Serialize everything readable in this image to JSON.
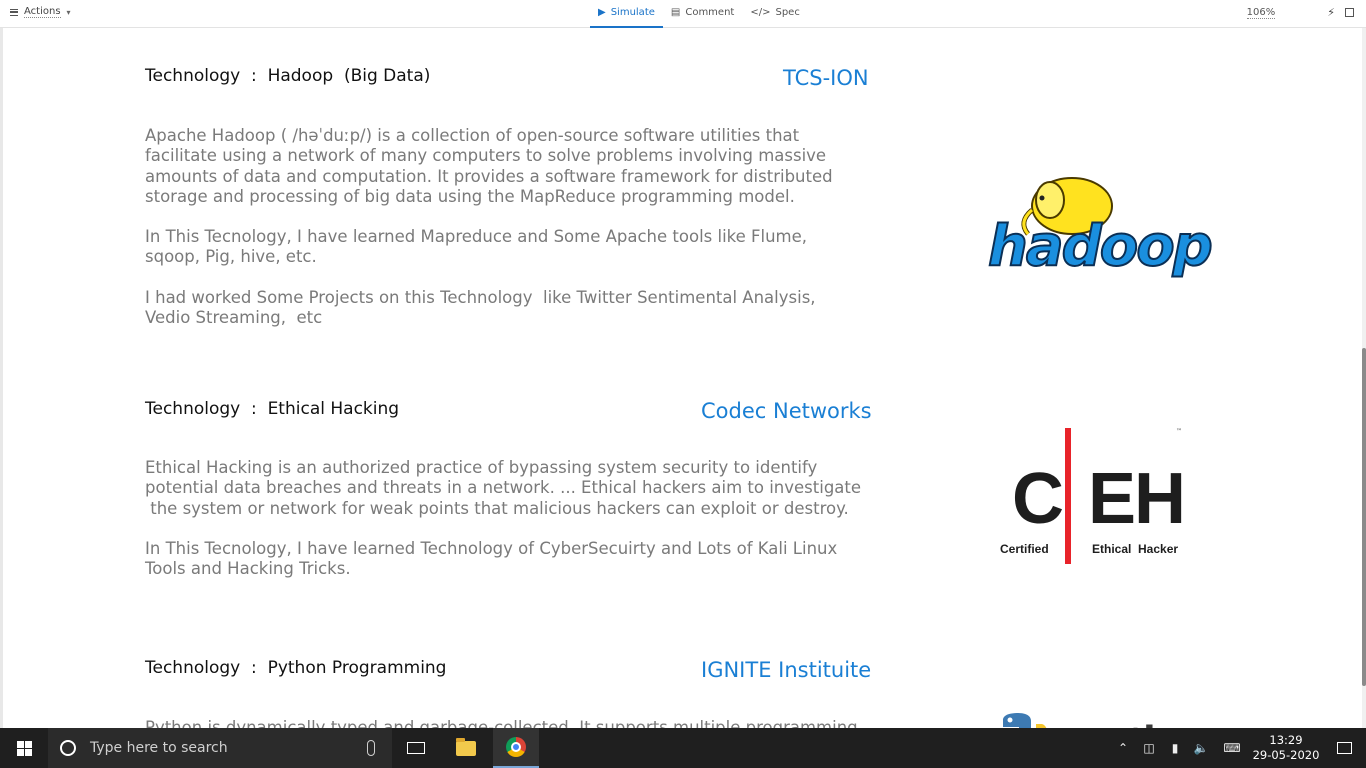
{
  "toolbar": {
    "actions_label": "Actions",
    "tabs": [
      {
        "label": "Simulate",
        "icon": "play-icon",
        "active": true
      },
      {
        "label": "Comment",
        "icon": "comment-icon",
        "active": false
      },
      {
        "label": "Spec",
        "icon": "code-icon",
        "active": false
      }
    ],
    "zoom": "106%"
  },
  "sections": [
    {
      "title": "Technology  :  Hadoop  (Big Data)",
      "org": "TCS-ION",
      "paragraphs": [
        "Apache Hadoop ( /həˈduːp/) is a collection of open-source software utilities that\nfacilitate using a network of many computers to solve problems involving massive\namounts of data and computation. It provides a software framework for distributed\nstorage and processing of big data using the MapReduce programming model.",
        "In This Tecnology, I have learned Mapreduce and Some Apache tools like Flume,\nsqoop, Pig, hive, etc.",
        "I had worked Some Projects on this Technology  like Twitter Sentimental Analysis,\nVedio Streaming,  etc"
      ],
      "logo": {
        "text": "hadoop",
        "icon": "hadoop-elephant-logo"
      }
    },
    {
      "title": "Technology  :  Ethical Hacking",
      "org": "Codec Networks",
      "paragraphs": [
        "Ethical Hacking is an authorized practice of bypassing system security to identify\npotential data breaches and threats in a network. ... Ethical hackers aim to investigate\n the system or network for weak points that malicious hackers can exploit or destroy.",
        "In This Tecnology, I have learned Technology of CyberSecuirty and Lots of Kali Linux\nTools and Hacking Tricks."
      ],
      "logo": {
        "letters": [
          "C",
          "E",
          "H"
        ],
        "left_caption": "Certified",
        "right_caption": "Ethical  Hacker",
        "tm": "™"
      }
    },
    {
      "title": "Technology  :  Python Programming",
      "org": "IGNITE Instituite",
      "paragraphs": [
        "Python is dynamically typed and garbage-collected. It supports multiple programming\nparadigms, including structured (particularly, procedural), object-oriented, and"
      ],
      "logo": {
        "text": "python",
        "icon": "python-logo"
      }
    }
  ],
  "taskbar": {
    "search_placeholder": "Type here to search",
    "time": "13:29",
    "date": "29-05-2020"
  }
}
